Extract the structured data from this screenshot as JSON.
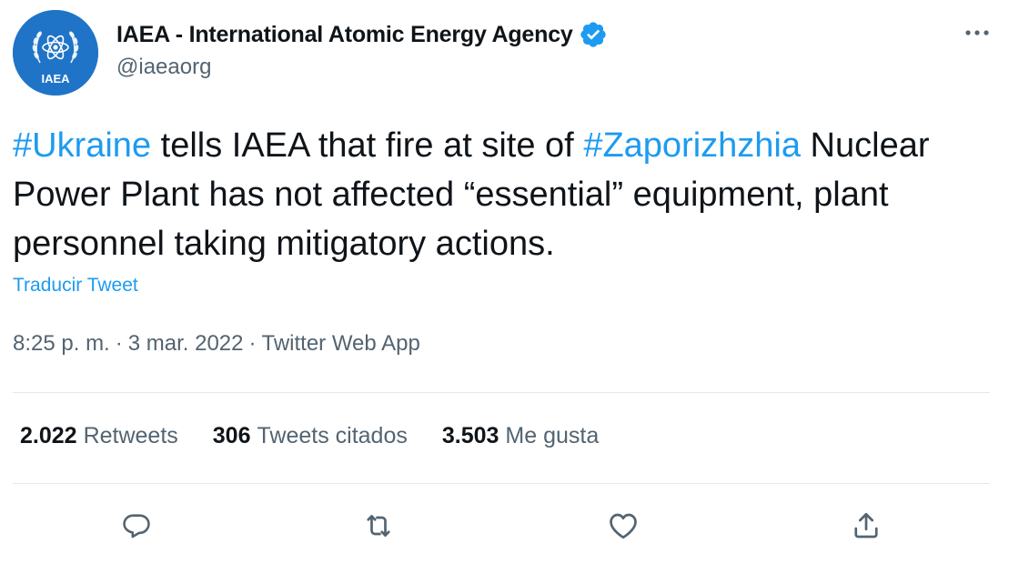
{
  "author": {
    "display_name": "IAEA - International Atomic Energy Agency",
    "handle": "@iaeaorg",
    "avatar_text": "IAEA",
    "verified": true,
    "avatar_color": "#1f74c8"
  },
  "tweet": {
    "hashtag_1": "#Ukraine",
    "text_1": " tells IAEA that fire at site of ",
    "hashtag_2": "#Zaporizhzhia",
    "text_2": " Nuclear Power Plant has not affected “essential” equipment, plant personnel taking mitigatory actions.",
    "translate_label": "Traducir Tweet"
  },
  "meta": {
    "time": "8:25 p. m.",
    "separator_1": "·",
    "date": "3 mar. 2022",
    "separator_2": "·",
    "source": "Twitter Web App"
  },
  "stats": {
    "retweets_count": "2.022",
    "retweets_label": "Retweets",
    "quotes_count": "306",
    "quotes_label": "Tweets citados",
    "likes_count": "3.503",
    "likes_label": "Me gusta"
  },
  "icons": {
    "more": "more-dots-icon",
    "verified": "verified-badge-icon",
    "reply": "reply-icon",
    "retweet": "retweet-icon",
    "like": "heart-icon",
    "share": "share-icon"
  },
  "colors": {
    "link": "#1d9bf0",
    "text": "#0f1419",
    "secondary": "#536471",
    "divider": "#e4e8eb"
  }
}
